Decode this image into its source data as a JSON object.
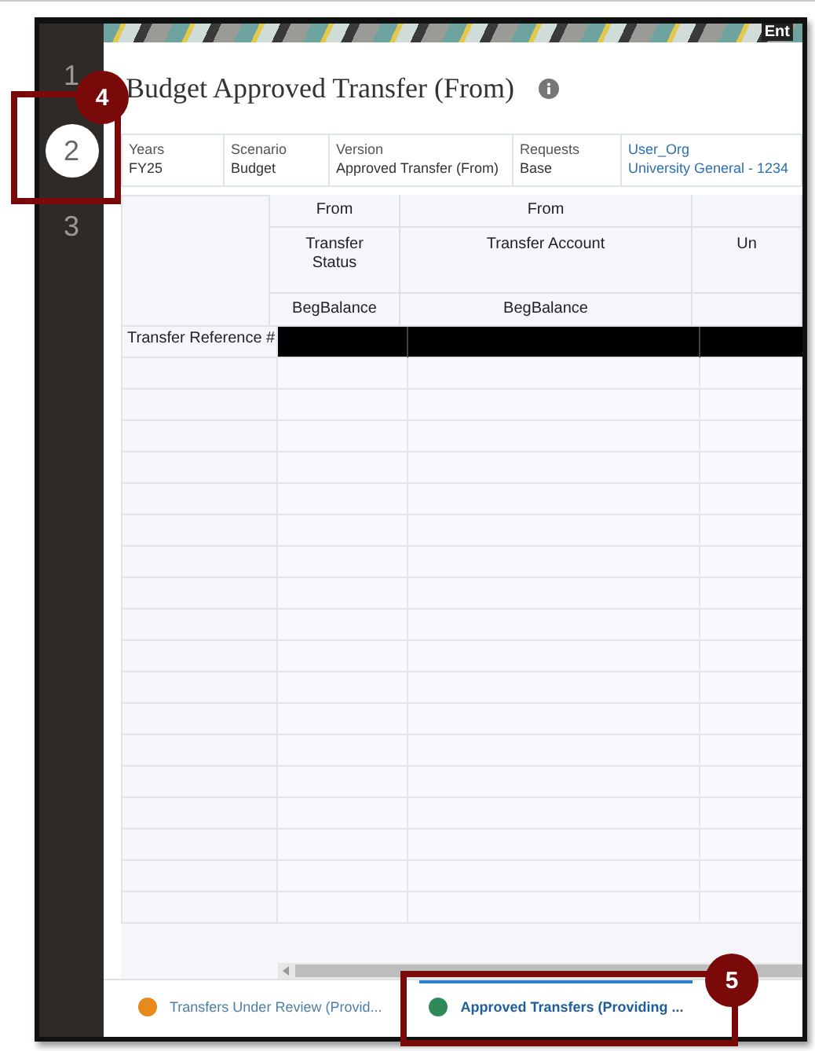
{
  "header": {
    "cut_text": "Ent"
  },
  "steps": [
    {
      "label": "1",
      "selected": false
    },
    {
      "label": "2",
      "selected": true
    },
    {
      "label": "3",
      "selected": false
    }
  ],
  "title": "Budget Approved Transfer (From)",
  "pov": [
    {
      "label": "Years",
      "value": "FY25",
      "kind": "plain"
    },
    {
      "label": "Scenario",
      "value": "Budget",
      "kind": "plain"
    },
    {
      "label": "Version",
      "value": "Approved Transfer (From)",
      "kind": "plain"
    },
    {
      "label": "Requests",
      "value": "Base",
      "kind": "plain"
    },
    {
      "label": "User_Org",
      "value": "University General - 1234",
      "kind": "link"
    }
  ],
  "grid": {
    "columns": [
      {
        "group": "From",
        "name": "Transfer Status",
        "period": "BegBalance"
      },
      {
        "group": "From",
        "name": "Transfer Account",
        "period": "BegBalance"
      },
      {
        "name": "Un"
      }
    ],
    "rows": [
      {
        "header": "Transfer Reference #",
        "selected": true
      }
    ]
  },
  "tabs": [
    {
      "label": "Transfers Under Review (Provid...",
      "color": "#e8891c",
      "selected": false
    },
    {
      "label": "Approved Transfers (Providing ...",
      "color": "#2e8b57",
      "selected": true
    }
  ],
  "callouts": [
    {
      "number": "4"
    },
    {
      "number": "5"
    }
  ]
}
